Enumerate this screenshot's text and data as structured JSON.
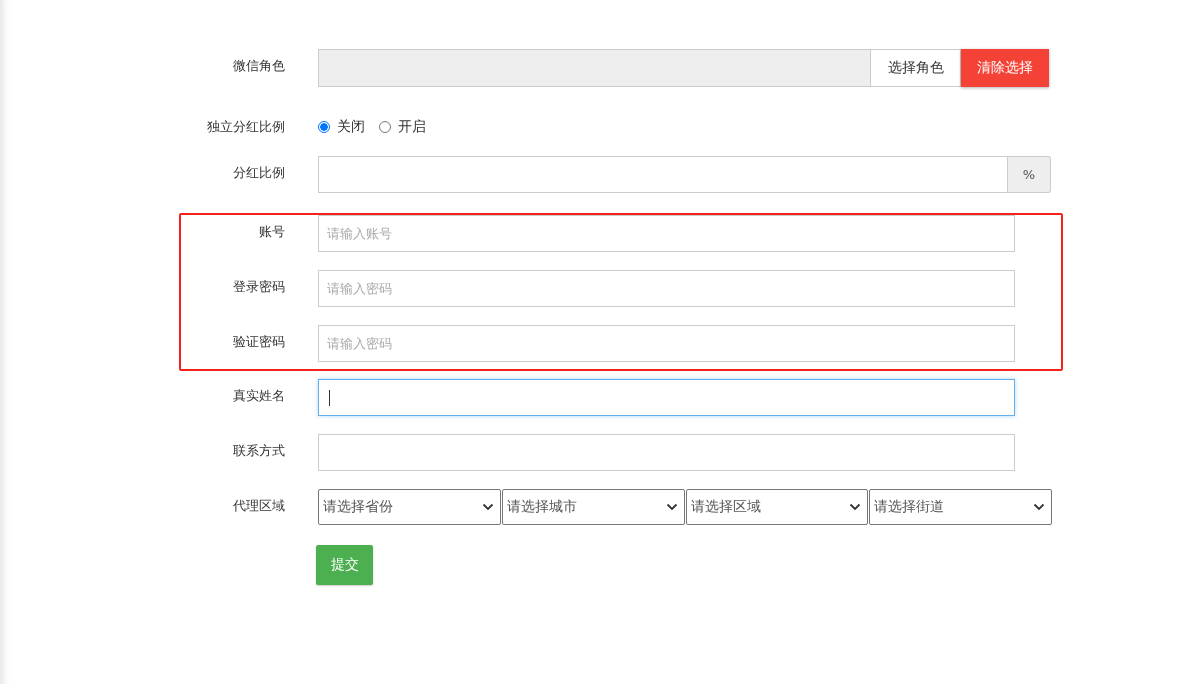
{
  "form": {
    "groups": [
      {
        "highlighted": false,
        "rows": [
          {
            "kind": "role_picker",
            "label": "微信角色",
            "value_disabled": true,
            "select_button": "选择角色",
            "clear_button": "清除选择"
          },
          {
            "kind": "radio",
            "label": "独立分红比例",
            "options": [
              {
                "label": "关闭",
                "selected": true
              },
              {
                "label": "开启",
                "selected": false
              }
            ]
          },
          {
            "kind": "addon_input",
            "label": "分红比例",
            "addon": "%"
          }
        ]
      },
      {
        "highlighted": true,
        "rows": [
          {
            "kind": "text",
            "label": "账号",
            "placeholder": "请输入账号",
            "focused": false
          },
          {
            "kind": "text",
            "label": "登录密码",
            "placeholder": "请输入密码",
            "focused": false
          },
          {
            "kind": "text",
            "label": "验证密码",
            "placeholder": "请输入密码",
            "focused": false
          }
        ]
      },
      {
        "highlighted": false,
        "rows": [
          {
            "kind": "text",
            "label": "真实姓名",
            "focused": true
          },
          {
            "kind": "text",
            "label": "联系方式",
            "focused": false
          },
          {
            "kind": "select_group",
            "label": "代理区域",
            "selects": [
              {
                "value": "请选择省份"
              },
              {
                "value": "请选择城市"
              },
              {
                "value": "请选择区域"
              },
              {
                "value": "请选择街道"
              }
            ]
          }
        ]
      }
    ],
    "submit": "提交"
  }
}
